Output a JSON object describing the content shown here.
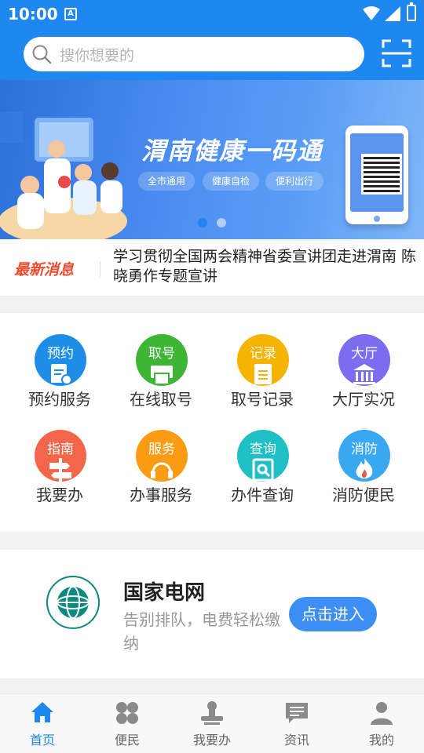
{
  "status_bar": {
    "time": "10:00",
    "notification_icon": "A"
  },
  "search": {
    "placeholder": "搜你想要的"
  },
  "banner": {
    "title": "渭南健康一码通",
    "tags": [
      "全市通用",
      "健康自检",
      "便利出行"
    ]
  },
  "news": {
    "tag": "最新消息",
    "headline": "学习贯彻全国两会精神省委宣讲团走进渭南 陈晓勇作专题宣讲"
  },
  "services": [
    {
      "label": "预约服务",
      "icon_text": "预约",
      "icon": "calendar-doc-icon",
      "color": "#1e8de8"
    },
    {
      "label": "在线取号",
      "icon_text": "取号",
      "icon": "ticket-machine-icon",
      "color": "#3fb536"
    },
    {
      "label": "取号记录",
      "icon_text": "记录",
      "icon": "clipboard-icon",
      "color": "#f5b400"
    },
    {
      "label": "大厅实况",
      "icon_text": "大厅",
      "icon": "building-icon",
      "color": "#7b6cf0"
    },
    {
      "label": "我要办",
      "icon_text": "指南",
      "icon": "signpost-icon",
      "color": "#f4664a"
    },
    {
      "label": "办事服务",
      "icon_text": "服务",
      "icon": "headset-icon",
      "color": "#f99c14"
    },
    {
      "label": "办件查询",
      "icon_text": "查询",
      "icon": "search-doc-icon",
      "color": "#1fbfc6"
    },
    {
      "label": "消防便民",
      "icon_text": "消防",
      "icon": "flame-icon",
      "color": "#3aa8f0"
    }
  ],
  "promo": {
    "title": "国家电网",
    "description": "告别排队，电费轻松缴纳",
    "button": "点击进入"
  },
  "tabbar": [
    {
      "label": "首页",
      "icon": "home-icon",
      "active": true
    },
    {
      "label": "便民",
      "icon": "grid-icon",
      "active": false
    },
    {
      "label": "我要办",
      "icon": "stamp-icon",
      "active": false
    },
    {
      "label": "资讯",
      "icon": "message-icon",
      "active": false
    },
    {
      "label": "我的",
      "icon": "user-icon",
      "active": false
    }
  ],
  "colors": {
    "primary": "#1e87f0",
    "news_tag": "#f04a2d",
    "promo_button": "#3d8ef5"
  }
}
